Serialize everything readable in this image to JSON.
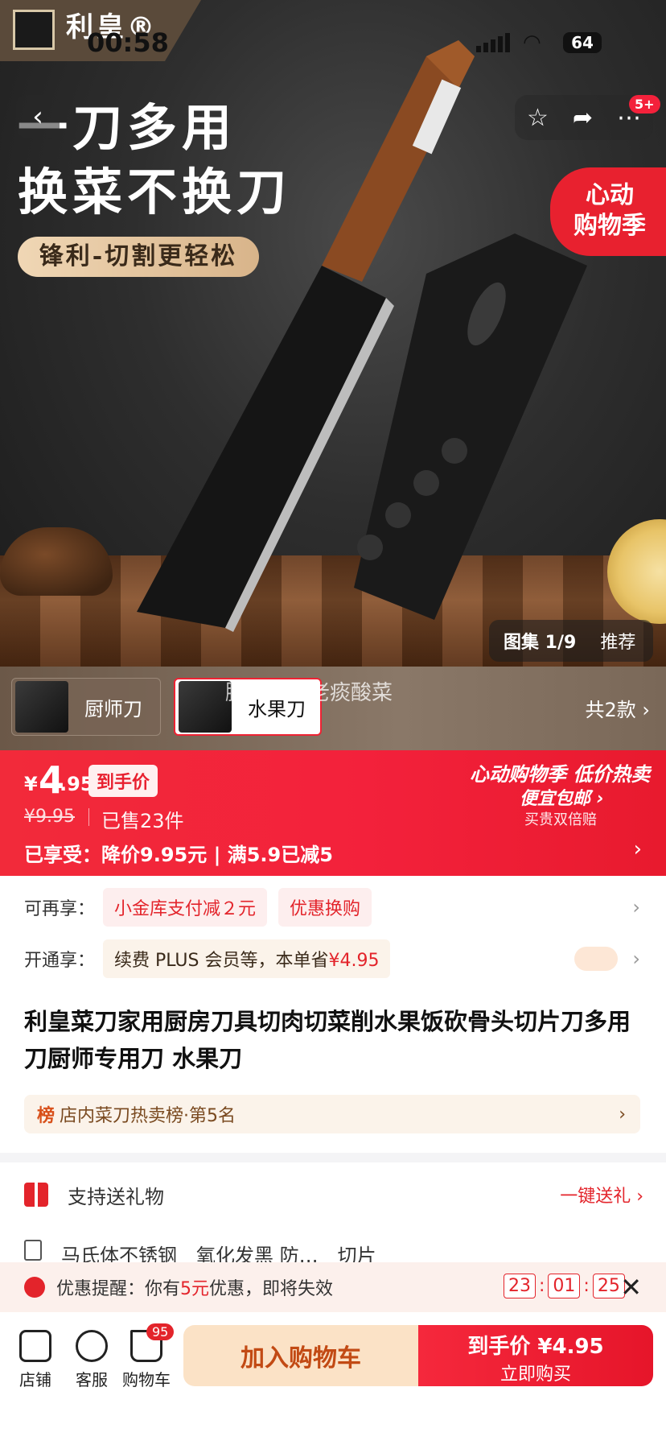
{
  "status": {
    "time": "00:58",
    "battery": "64"
  },
  "brand": {
    "name": "利皇®"
  },
  "hero": {
    "headline1": "一刀多用",
    "headline2": "换菜不换刀",
    "subline": "锋利-切割更轻松",
    "promo_circle": "心动\n购物季",
    "badge": "5+",
    "gallery_label": "图集 1/9",
    "gallery_recommend": "推荐"
  },
  "variants": {
    "items": [
      {
        "label": "厨师刀"
      },
      {
        "label": "水果刀"
      }
    ],
    "overlay": "脚尖上的老痰酸菜",
    "total": "共2款"
  },
  "price": {
    "yen": "¥",
    "integer": "4",
    "decimal": ".95",
    "tag": "到手价",
    "original": "¥9.95",
    "sold": "已售23件",
    "enjoy": "已享受：降价9.95元 | 满5.9已减5",
    "promo_title": "心动购物季 低价热卖",
    "promo_sub": "便宜包邮 ›",
    "promo_sub2": "买贵双倍赔"
  },
  "extra": {
    "label": "可再享：",
    "chips": [
      "小金库支付减２元",
      "优惠换购"
    ]
  },
  "plus": {
    "label": "开通享：",
    "text": "续费 PLUS 会员等，本单省",
    "amount": "¥4.95"
  },
  "product": {
    "title": "利皇菜刀家用厨房刀具切肉切菜削水果饭砍骨头切片刀多用刀厨师专用刀 水果刀",
    "rank_mark": "榜",
    "rank_text": "店内菜刀热卖榜·第5名"
  },
  "gift": {
    "label": "支持送礼物",
    "link": "一键送礼 ›"
  },
  "specs": [
    "马氏体不锈钢",
    "氧化发黑 防…",
    "切片"
  ],
  "notice": {
    "prefix": "优惠提醒：你有",
    "amount": "5元",
    "suffix": "优惠，即将失效",
    "hh": "23",
    "mm": "01",
    "ss": "25"
  },
  "bottom": {
    "shop": "店铺",
    "service": "客服",
    "cart": "购物车",
    "cart_count": "95",
    "add_cart": "加入购物车",
    "buy_l1": "到手价 ¥4.95",
    "buy_l2": "立即购买"
  }
}
